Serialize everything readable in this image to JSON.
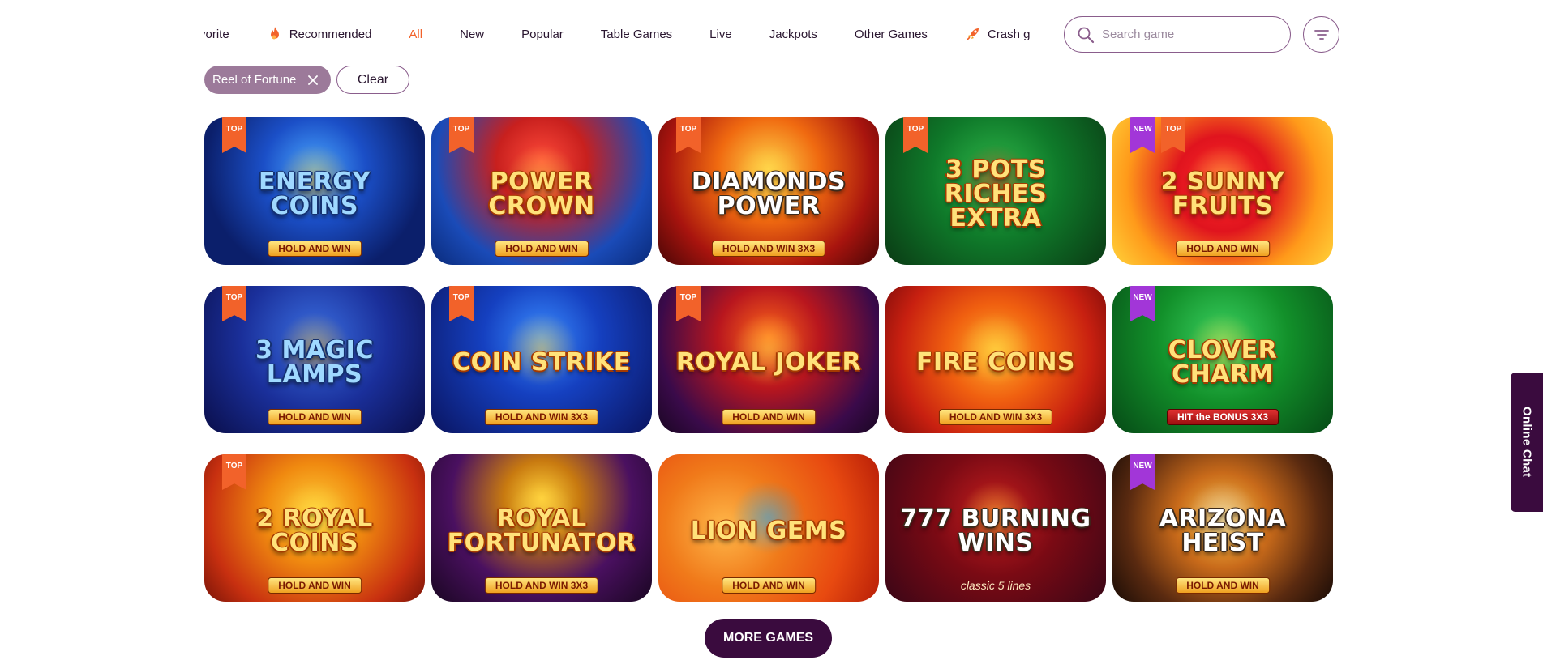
{
  "categories": [
    {
      "label": "vorite",
      "icon": "",
      "active": false
    },
    {
      "label": "Recommended",
      "icon": "flame-icon",
      "active": false
    },
    {
      "label": "All",
      "icon": "",
      "active": true
    },
    {
      "label": "New",
      "icon": "",
      "active": false
    },
    {
      "label": "Popular",
      "icon": "",
      "active": false
    },
    {
      "label": "Table Games",
      "icon": "",
      "active": false
    },
    {
      "label": "Live",
      "icon": "",
      "active": false
    },
    {
      "label": "Jackpots",
      "icon": "",
      "active": false
    },
    {
      "label": "Other Games",
      "icon": "",
      "active": false
    },
    {
      "label": "Crash g",
      "icon": "rocket-icon",
      "active": false
    }
  ],
  "search": {
    "placeholder": "Search game",
    "value": ""
  },
  "filters": {
    "active_chip": "Reel of Fortune",
    "clear_label": "Clear"
  },
  "games": [
    {
      "title": "Energy Coins",
      "subtitle": "HOLD AND WIN",
      "badges": [
        "TOP"
      ],
      "style": "blue",
      "bg": "radial-gradient(circle at 50% 35%, #4aa8ff 0%, #1b4fc7 35%, #0b1f6b 75%)",
      "accent": "#f0b830"
    },
    {
      "title": "Power Crown",
      "subtitle": "HOLD AND WIN",
      "badges": [
        "TOP"
      ],
      "style": "gold",
      "bg": "radial-gradient(circle at 50% 30%, #ff4a3a 0%, #c8201e 30%, #1a4bb8 70%, #0a2a7a 100%)",
      "accent": "#ffd24a"
    },
    {
      "title": "Diamonds Power",
      "subtitle": "HOLD AND WIN 3X3",
      "badges": [
        "TOP"
      ],
      "style": "white",
      "bg": "radial-gradient(circle at 50% 35%, #ffd54a 0%, #f06a10 35%, #a8140e 70%, #4a0606 100%)",
      "accent": "#ffd54a"
    },
    {
      "title": "3 Pots Riches Extra",
      "subtitle": "",
      "badges": [
        "TOP"
      ],
      "style": "gold",
      "bg": "radial-gradient(circle at 50% 40%, #2fb84a 0%, #0f7a2a 45%, #0a3a14 100%)",
      "accent": "#d83018"
    },
    {
      "title": "2 Sunny Fruits",
      "subtitle": "HOLD AND WIN",
      "badges": [
        "NEW",
        "TOP"
      ],
      "style": "gold",
      "bg": "radial-gradient(circle at 50% 45%, #ff2a2a 0%, #e0141e 35%, #ff9a1a 70%, #ffd23a 100%)",
      "accent": "#ffe04a"
    },
    {
      "title": "3 Magic Lamps",
      "subtitle": "HOLD AND WIN",
      "badges": [
        "TOP"
      ],
      "style": "blue",
      "bg": "radial-gradient(circle at 50% 35%, #3a6ee0 0%, #1a2f9a 50%, #0a0e4a 100%)",
      "accent": "#f0b830"
    },
    {
      "title": "Coin Strike",
      "subtitle": "HOLD AND WIN 3X3",
      "badges": [
        "TOP"
      ],
      "style": "gold",
      "bg": "radial-gradient(circle at 50% 35%, #3a8cff 0%, #1540c0 40%, #0a1460 100%)",
      "accent": "#ffd54a"
    },
    {
      "title": "Royal Joker",
      "subtitle": "HOLD AND WIN",
      "badges": [
        "TOP"
      ],
      "style": "gold",
      "bg": "radial-gradient(circle at 50% 35%, #ff6a1a 0%, #b8161e 35%, #3a0a4a 75%, #1a0622 100%)",
      "accent": "#ffd54a"
    },
    {
      "title": "Fire Coins",
      "subtitle": "HOLD AND WIN 3X3",
      "badges": [],
      "style": "gold",
      "bg": "radial-gradient(circle at 50% 45%, #ffb02a 0%, #f06010 35%, #c82010 70%, #7a0a0a 100%)",
      "accent": "#ffe04a"
    },
    {
      "title": "Clover Charm",
      "subtitle": "HIT the BONUS 3X3",
      "badges": [
        "NEW"
      ],
      "style": "gold",
      "bg": "radial-gradient(circle at 50% 35%, #3ad060 0%, #12902a 45%, #064a16 100%)",
      "accent": "#ffd54a"
    },
    {
      "title": "2 Royal Coins",
      "subtitle": "HOLD AND WIN",
      "badges": [
        "TOP"
      ],
      "style": "gold",
      "bg": "radial-gradient(circle at 50% 40%, #ffd23a 0%, #f08a10 35%, #c83010 75%, #7a1408 100%)",
      "accent": "#ffe04a"
    },
    {
      "title": "Royal Fortunator",
      "subtitle": "HOLD AND WIN 3X3",
      "badges": [],
      "style": "gold",
      "bg": "radial-gradient(circle at 50% 30%, #ffd23a 0%, #c87a10 25%, #4a1060 60%, #1a0622 100%)",
      "accent": "#ffd54a"
    },
    {
      "title": "Lion Gems",
      "subtitle": "HOLD AND WIN",
      "badges": [],
      "style": "gold",
      "bg": "radial-gradient(circle at 30% 50%, #ffb84a 0%, #f07a1a 35%, #e84a10 70%, #b81e08 100%)",
      "accent": "#1aa8ff"
    },
    {
      "title": "777 Burning Wins",
      "subtitle": "classic 5 lines",
      "badges": [],
      "style": "white",
      "bg": "radial-gradient(circle at 50% 40%, #c81e1e 0%, #7a0a14 45%, #3a0616 100%)",
      "accent": "#ffd23a"
    },
    {
      "title": "Arizona Heist",
      "subtitle": "HOLD AND WIN",
      "badges": [
        "NEW"
      ],
      "style": "white",
      "bg": "radial-gradient(circle at 50% 45%, #ffc84a 0%, #c86a1a 35%, #5a2a10 70%, #1a0c06 100%)",
      "accent": "#e0e0e0"
    }
  ],
  "more_games_label": "MORE GAMES",
  "online_chat_label": "Online Chat",
  "colors": {
    "accent_orange": "#f2622a",
    "brand_dark": "#3a0b3e",
    "chip_bg": "#9c7a9a",
    "badge_top": "#f2622a",
    "badge_new": "#a236d8"
  }
}
